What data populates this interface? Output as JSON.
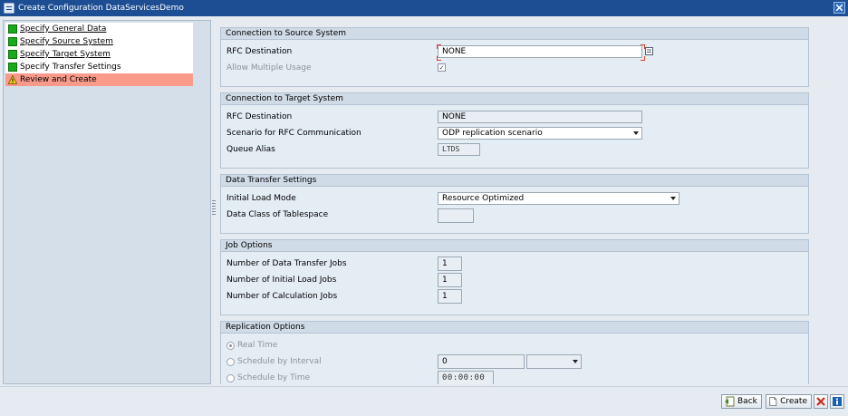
{
  "window": {
    "title": "Create Configuration DataServicesDemo"
  },
  "steps": [
    {
      "label": "Specify General Data",
      "status": "done"
    },
    {
      "label": "Specify Source System",
      "status": "done"
    },
    {
      "label": "Specify Target System",
      "status": "done"
    },
    {
      "label": "Specify Transfer Settings",
      "status": "done"
    },
    {
      "label": "Review and Create",
      "status": "warning"
    }
  ],
  "source_system": {
    "heading": "Connection to Source System",
    "rfc_label": "RFC Destination",
    "rfc_value": "NONE",
    "multi_label": "Allow Multiple Usage",
    "multi_checked": true
  },
  "target_system": {
    "heading": "Connection to Target System",
    "rfc_label": "RFC Destination",
    "rfc_value": "NONE",
    "scenario_label": "Scenario for RFC Communication",
    "scenario_value": "ODP replication scenario",
    "alias_label": "Queue Alias",
    "alias_value": "LTDS"
  },
  "transfer": {
    "heading": "Data Transfer Settings",
    "load_mode_label": "Initial Load Mode",
    "load_mode_value": "Resource Optimized",
    "tablespace_label": "Data Class of Tablespace",
    "tablespace_value": ""
  },
  "jobs": {
    "heading": "Job Options",
    "transfer_label": "Number of Data Transfer Jobs",
    "transfer_value": "1",
    "initial_label": "Number of Initial Load Jobs",
    "initial_value": "1",
    "calc_label": "Number of Calculation Jobs",
    "calc_value": "1"
  },
  "replication": {
    "heading": "Replication Options",
    "realtime_label": "Real Time",
    "interval_label": "Schedule by Interval",
    "interval_value": "0",
    "interval_unit": "",
    "time_label": "Schedule by Time",
    "time_value": "00:00:00",
    "selected": "Real Time"
  },
  "footer": {
    "back_label": "Back",
    "create_label": "Create"
  }
}
